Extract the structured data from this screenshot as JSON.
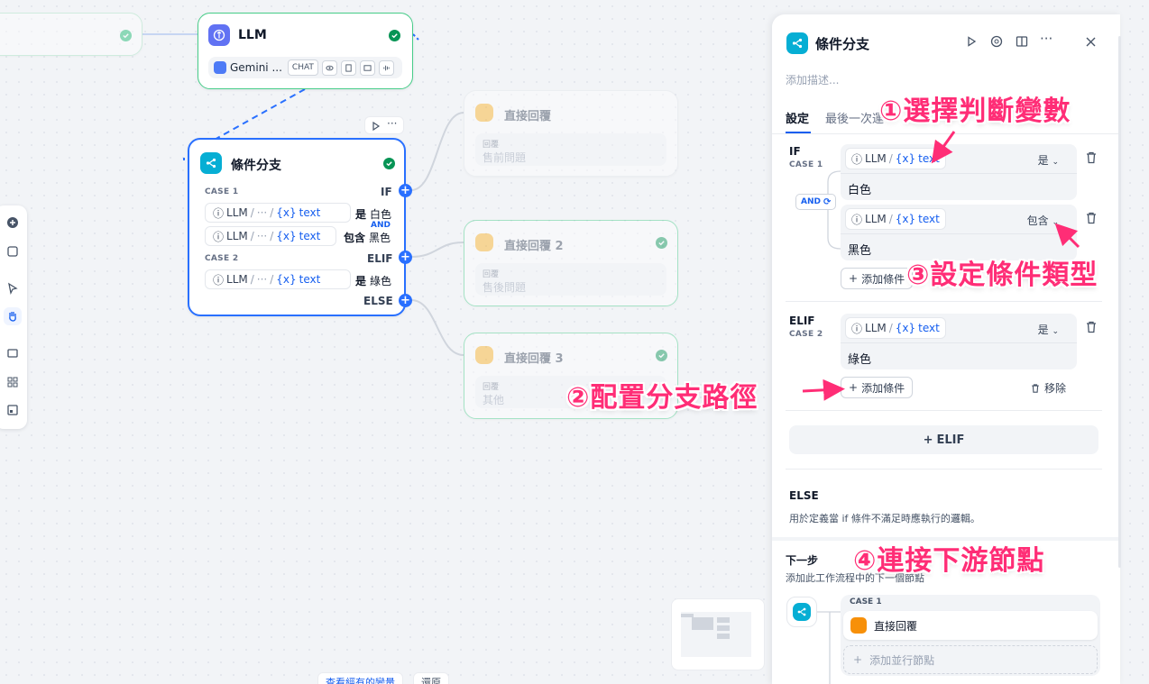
{
  "canvas": {
    "llm_node": {
      "title": "LLM",
      "model": "Gemini ...",
      "mode_chip": "CHAT"
    },
    "if_node": {
      "title": "條件分支",
      "case1_label": "CASE 1",
      "case2_label": "CASE 2",
      "if_label": "IF",
      "elif_label": "ELIF",
      "else_label": "ELSE",
      "and_label": "AND",
      "var_node": "LLM",
      "var_dots": "···",
      "var_name": "text",
      "conditions": [
        {
          "op": "是",
          "value": "白色"
        },
        {
          "op": "包含",
          "value": "黑色"
        },
        {
          "op": "是",
          "value": "綠色"
        }
      ]
    },
    "reply_nodes": [
      {
        "title": "直接回覆",
        "label": "回覆",
        "text": "售前問題"
      },
      {
        "title": "直接回覆 2",
        "label": "回覆",
        "text": "售後問題"
      },
      {
        "title": "直接回覆 3",
        "label": "回覆",
        "text": "其他"
      }
    ]
  },
  "panel": {
    "title": "條件分支",
    "description_placeholder": "添加描述...",
    "tabs": [
      "設定",
      "最後一次運"
    ],
    "if_label": "IF",
    "case1": "CASE 1",
    "elif_label": "ELIF",
    "case2": "CASE 2",
    "and_label": "AND",
    "var_node": "LLM",
    "var_name": "text",
    "conditions": [
      {
        "op": "是",
        "value": "白色"
      },
      {
        "op": "包含",
        "value": "黑色"
      },
      {
        "op": "是",
        "value": "綠色"
      }
    ],
    "add_condition": "添加條件",
    "remove": "移除",
    "add_elif": "ELIF",
    "else_label": "ELSE",
    "else_desc": "用於定義當 if 條件不滿足時應執行的邏輯。",
    "next_title": "下一步",
    "next_desc": "添加此工作流程中的下一個節點",
    "next_case": "CASE 1",
    "next_node": "直接回覆",
    "add_parallel": "添加並行節點"
  },
  "annotations": {
    "a1": "①選擇判斷變數",
    "a2": "②配置分支路徑",
    "a3": "③設定條件類型",
    "a4": "④連接下游節點"
  },
  "bottom": {
    "btn1": "查看經有的變量",
    "btn2": "還原"
  },
  "colors": {
    "accent": "#155eef",
    "annotation": "#ff2d76",
    "if_node": "#06aed4",
    "reply_node": "#f79009"
  }
}
